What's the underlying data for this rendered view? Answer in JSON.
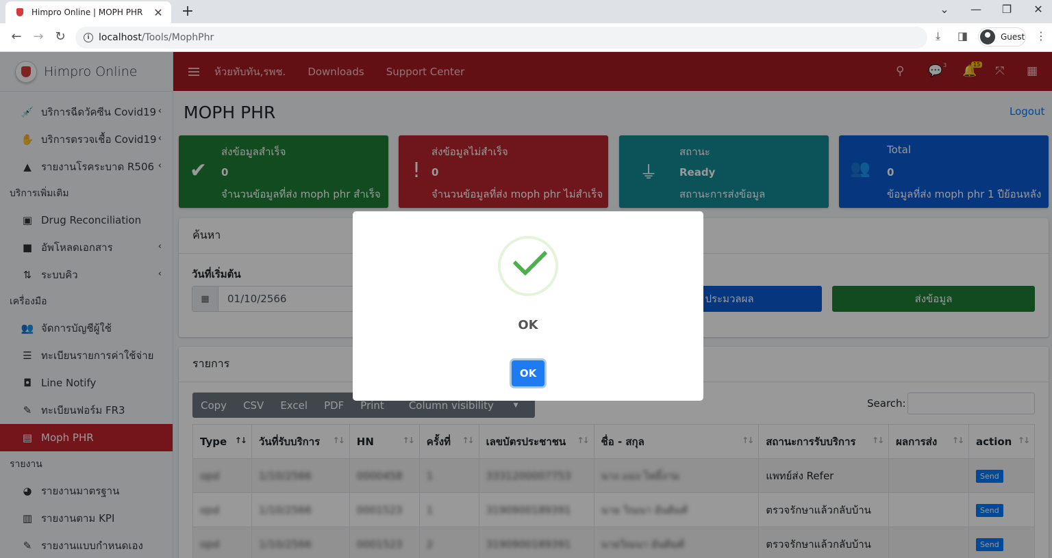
{
  "browser": {
    "tab_title": "Himpro Online | MOPH PHR",
    "url_host": "localhost",
    "url_path": "/Tools/MophPhr",
    "guest_label": "Guest"
  },
  "brand": {
    "name": "Himpro Online"
  },
  "sidebar": {
    "items_top": [
      {
        "label": "บริการฉีดวัคซีน Covid19",
        "icon": "syringe-icon"
      },
      {
        "label": "บริการตรวจเชื้อ Covid19",
        "icon": "hand-test-icon"
      },
      {
        "label": "รายงานโรคระบาด R506",
        "icon": "warning-icon"
      }
    ],
    "header_extra": "บริการเพิ่มเติม",
    "items_extra": [
      {
        "label": "Drug Reconciliation",
        "icon": "file-icon"
      },
      {
        "label": "อัพโหลดเอกสาร",
        "icon": "folder-icon"
      },
      {
        "label": "ระบบคิว",
        "icon": "sort-icon"
      }
    ],
    "header_tools": "เครื่องมือ",
    "items_tools": [
      {
        "label": "จัดการบัญชีผู้ใช้",
        "icon": "users-icon"
      },
      {
        "label": "ทะเบียนรายการค่าใช้จ่าย",
        "icon": "list-icon"
      },
      {
        "label": "Line Notify",
        "icon": "line-icon"
      },
      {
        "label": "ทะเบียนฟอร์ม FR3",
        "icon": "edit-icon"
      },
      {
        "label": "Moph PHR",
        "icon": "file-upload-icon"
      }
    ],
    "header_reports": "รายงาน",
    "items_reports": [
      {
        "label": "รายงานมาตรฐาน",
        "icon": "pie-icon"
      },
      {
        "label": "รายงานตาม KPI",
        "icon": "chart-icon"
      },
      {
        "label": "รายงานแบบกำหนดเอง",
        "icon": "edit-icon"
      }
    ]
  },
  "topnav": {
    "hospital": "ห้วยทับทัน,รพช.",
    "downloads": "Downloads",
    "support": "Support Center",
    "chat_count": "3",
    "notif_count": "15"
  },
  "page": {
    "title": "MOPH PHR",
    "logout": "Logout"
  },
  "info_boxes": [
    {
      "line1": "ส่งข้อมูลสำเร็จ",
      "line2": "0",
      "line3": "จำนวนข้อมูลที่ส่ง moph phr สำเร็จ",
      "color": "#1e7e34"
    },
    {
      "line1": "ส่งข้อมูลไม่สำเร็จ",
      "line2": "0",
      "line3": "จำนวนข้อมูลที่ส่ง moph phr ไม่สำเร็จ",
      "color": "#b8262f"
    },
    {
      "line1": "สถานะ",
      "line2": "Ready",
      "line3": "สถานะการส่งข้อมูล",
      "color": "#138a94"
    },
    {
      "line1": "Total",
      "line2": "0",
      "line3": "ข้อมูลที่ส่ง moph phr 1 ปีย้อนหลัง",
      "color": "#0a5bd0"
    }
  ],
  "search_card": {
    "title": "ค้นหา",
    "start_label": "วันที่เริ่มต้น",
    "start_value": "01/10/2566",
    "process_btn": "ประมวลผล",
    "send_btn": "ส่งข้อมูล"
  },
  "list_card": {
    "title": "รายการ",
    "buttons": [
      "Copy",
      "CSV",
      "Excel",
      "PDF",
      "Print",
      "Column visibility"
    ],
    "search_label": "Search:",
    "columns": [
      "Type",
      "วันที่รับบริการ",
      "HN",
      "ครั้งที่",
      "เลขบัตรประชาชน",
      "ชื่อ - สกุล",
      "สถานะการรับบริการ",
      "ผลการส่ง",
      "action"
    ],
    "rows": [
      {
        "type": "opd",
        "date": "1/10/2566",
        "hn": "0000458",
        "seq": "1",
        "cid": "3331200007753",
        "name": "นาง แม่ง ไพธิ์งาม",
        "status": "แพทย์ส่ง Refer",
        "result": "",
        "action": "Send"
      },
      {
        "type": "opd",
        "date": "1/10/2566",
        "hn": "0001523",
        "seq": "1",
        "cid": "3190900189391",
        "name": "นาย วิณนา อันติมศ์",
        "status": "ตรวจรักษาแล้วกลับบ้าน",
        "result": "",
        "action": "Send"
      },
      {
        "type": "opd",
        "date": "1/10/2566",
        "hn": "0001523",
        "seq": "2",
        "cid": "3190900189391",
        "name": "นายวิณนา อันติมศ์",
        "status": "ตรวจรักษาแล้วกลับบ้าน",
        "result": "",
        "action": "Send"
      }
    ]
  },
  "modal": {
    "title": "OK",
    "button": "OK"
  }
}
